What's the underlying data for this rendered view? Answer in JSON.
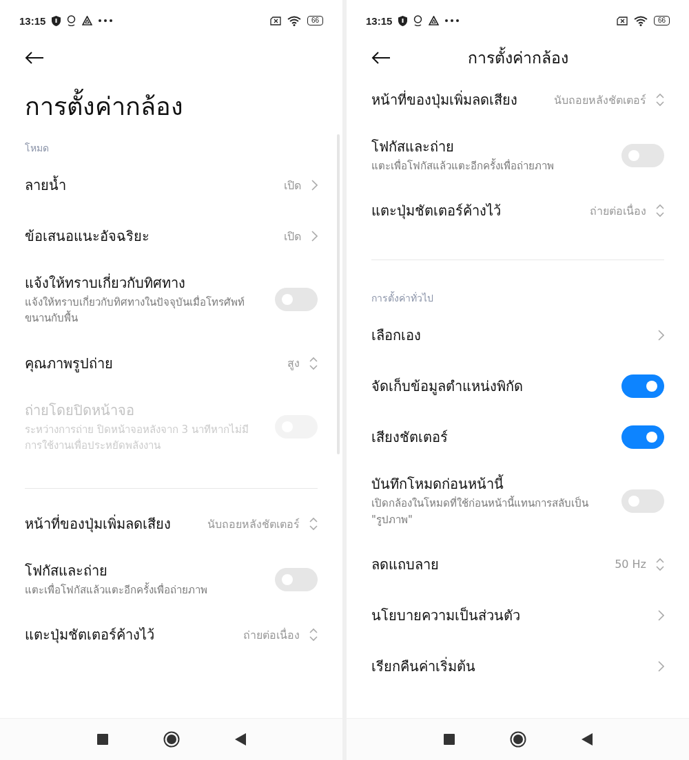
{
  "screens": [
    {
      "status_bar": {
        "time": "13:15",
        "battery": "66"
      },
      "header": {
        "kind": "large",
        "title": "การตั้งค่ากล้อง"
      },
      "items": [
        {
          "kind": "section",
          "label": "โหมด"
        },
        {
          "kind": "link",
          "title": "ลายน้ำ",
          "value": "เปิด"
        },
        {
          "kind": "link",
          "title": "ข้อเสนอแนะอัจฉริยะ",
          "value": "เปิด"
        },
        {
          "kind": "toggle",
          "title": "แจ้งให้ทราบเกี่ยวกับทิศทาง",
          "subtitle": "แจ้งให้ทราบเกี่ยวกับทิศทางในปัจจุบันเมื่อโทรศัพท์ขนานกับพื้น",
          "on": false,
          "disabled": false
        },
        {
          "kind": "select",
          "title": "คุณภาพรูปถ่าย",
          "value": "สูง"
        },
        {
          "kind": "toggle",
          "title": "ถ่ายโดยปิดหน้าจอ",
          "subtitle": "ระหว่างการถ่าย ปิดหน้าจอหลังจาก 3 นาทีหากไม่มีการใช้งานเพื่อประหยัดพลังงาน",
          "on": false,
          "disabled": true
        },
        {
          "kind": "divider"
        },
        {
          "kind": "select",
          "title": "หน้าที่ของปุ่มเพิ่มลดเสียง",
          "value": "นับถอยหลังชัตเตอร์"
        },
        {
          "kind": "toggle",
          "title": "โฟกัสและถ่าย",
          "subtitle": "แตะเพื่อโฟกัสแล้วแตะอีกครั้งเพื่อถ่ายภาพ",
          "on": false,
          "disabled": false
        },
        {
          "kind": "select",
          "title": "แตะปุ่มชัตเตอร์ค้างไว้",
          "value": "ถ่ายต่อเนื่อง"
        }
      ]
    },
    {
      "status_bar": {
        "time": "13:15",
        "battery": "66"
      },
      "header": {
        "kind": "bar",
        "title": "การตั้งค่ากล้อง"
      },
      "items": [
        {
          "kind": "select",
          "title": "หน้าที่ของปุ่มเพิ่มลดเสียง",
          "value": "นับถอยหลังชัตเตอร์"
        },
        {
          "kind": "toggle",
          "title": "โฟกัสและถ่าย",
          "subtitle": "แตะเพื่อโฟกัสแล้วแตะอีกครั้งเพื่อถ่ายภาพ",
          "on": false,
          "disabled": false
        },
        {
          "kind": "select",
          "title": "แตะปุ่มชัตเตอร์ค้างไว้",
          "value": "ถ่ายต่อเนื่อง"
        },
        {
          "kind": "divider"
        },
        {
          "kind": "section",
          "label": "การตั้งค่าทั่วไป"
        },
        {
          "kind": "link",
          "title": "เลือกเอง"
        },
        {
          "kind": "toggle",
          "title": "จัดเก็บข้อมูลตำแหน่งพิกัด",
          "on": true,
          "disabled": false
        },
        {
          "kind": "toggle",
          "title": "เสียงชัตเตอร์",
          "on": true,
          "disabled": false
        },
        {
          "kind": "toggle",
          "title": "บันทึกโหมดก่อนหน้านี้",
          "subtitle": "เปิดกล้องในโหมดที่ใช้ก่อนหน้านี้แทนการสลับเป็น \"รูปภาพ\"",
          "on": false,
          "disabled": false
        },
        {
          "kind": "select",
          "title": "ลดแถบลาย",
          "value": "50 Hz"
        },
        {
          "kind": "link",
          "title": "นโยบายความเป็นส่วนตัว"
        },
        {
          "kind": "link",
          "title": "เรียกคืนค่าเริ่มต้น"
        }
      ]
    }
  ]
}
